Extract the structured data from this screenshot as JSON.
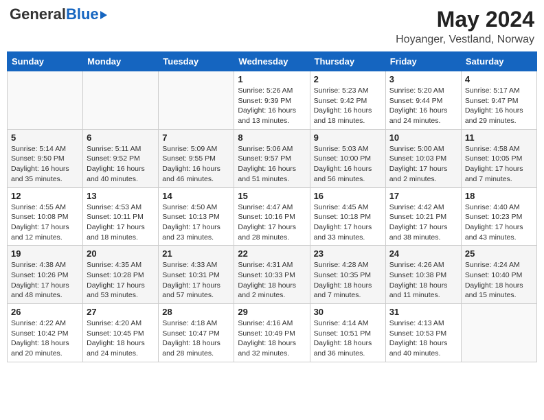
{
  "header": {
    "logo_general": "General",
    "logo_blue": "Blue",
    "main_title": "May 2024",
    "subtitle": "Hoyanger, Vestland, Norway"
  },
  "days_of_week": [
    "Sunday",
    "Monday",
    "Tuesday",
    "Wednesday",
    "Thursday",
    "Friday",
    "Saturday"
  ],
  "weeks": [
    [
      {
        "day": "",
        "info": ""
      },
      {
        "day": "",
        "info": ""
      },
      {
        "day": "",
        "info": ""
      },
      {
        "day": "1",
        "info": "Sunrise: 5:26 AM\nSunset: 9:39 PM\nDaylight: 16 hours and 13 minutes."
      },
      {
        "day": "2",
        "info": "Sunrise: 5:23 AM\nSunset: 9:42 PM\nDaylight: 16 hours and 18 minutes."
      },
      {
        "day": "3",
        "info": "Sunrise: 5:20 AM\nSunset: 9:44 PM\nDaylight: 16 hours and 24 minutes."
      },
      {
        "day": "4",
        "info": "Sunrise: 5:17 AM\nSunset: 9:47 PM\nDaylight: 16 hours and 29 minutes."
      }
    ],
    [
      {
        "day": "5",
        "info": "Sunrise: 5:14 AM\nSunset: 9:50 PM\nDaylight: 16 hours and 35 minutes."
      },
      {
        "day": "6",
        "info": "Sunrise: 5:11 AM\nSunset: 9:52 PM\nDaylight: 16 hours and 40 minutes."
      },
      {
        "day": "7",
        "info": "Sunrise: 5:09 AM\nSunset: 9:55 PM\nDaylight: 16 hours and 46 minutes."
      },
      {
        "day": "8",
        "info": "Sunrise: 5:06 AM\nSunset: 9:57 PM\nDaylight: 16 hours and 51 minutes."
      },
      {
        "day": "9",
        "info": "Sunrise: 5:03 AM\nSunset: 10:00 PM\nDaylight: 16 hours and 56 minutes."
      },
      {
        "day": "10",
        "info": "Sunrise: 5:00 AM\nSunset: 10:03 PM\nDaylight: 17 hours and 2 minutes."
      },
      {
        "day": "11",
        "info": "Sunrise: 4:58 AM\nSunset: 10:05 PM\nDaylight: 17 hours and 7 minutes."
      }
    ],
    [
      {
        "day": "12",
        "info": "Sunrise: 4:55 AM\nSunset: 10:08 PM\nDaylight: 17 hours and 12 minutes."
      },
      {
        "day": "13",
        "info": "Sunrise: 4:53 AM\nSunset: 10:11 PM\nDaylight: 17 hours and 18 minutes."
      },
      {
        "day": "14",
        "info": "Sunrise: 4:50 AM\nSunset: 10:13 PM\nDaylight: 17 hours and 23 minutes."
      },
      {
        "day": "15",
        "info": "Sunrise: 4:47 AM\nSunset: 10:16 PM\nDaylight: 17 hours and 28 minutes."
      },
      {
        "day": "16",
        "info": "Sunrise: 4:45 AM\nSunset: 10:18 PM\nDaylight: 17 hours and 33 minutes."
      },
      {
        "day": "17",
        "info": "Sunrise: 4:42 AM\nSunset: 10:21 PM\nDaylight: 17 hours and 38 minutes."
      },
      {
        "day": "18",
        "info": "Sunrise: 4:40 AM\nSunset: 10:23 PM\nDaylight: 17 hours and 43 minutes."
      }
    ],
    [
      {
        "day": "19",
        "info": "Sunrise: 4:38 AM\nSunset: 10:26 PM\nDaylight: 17 hours and 48 minutes."
      },
      {
        "day": "20",
        "info": "Sunrise: 4:35 AM\nSunset: 10:28 PM\nDaylight: 17 hours and 53 minutes."
      },
      {
        "day": "21",
        "info": "Sunrise: 4:33 AM\nSunset: 10:31 PM\nDaylight: 17 hours and 57 minutes."
      },
      {
        "day": "22",
        "info": "Sunrise: 4:31 AM\nSunset: 10:33 PM\nDaylight: 18 hours and 2 minutes."
      },
      {
        "day": "23",
        "info": "Sunrise: 4:28 AM\nSunset: 10:35 PM\nDaylight: 18 hours and 7 minutes."
      },
      {
        "day": "24",
        "info": "Sunrise: 4:26 AM\nSunset: 10:38 PM\nDaylight: 18 hours and 11 minutes."
      },
      {
        "day": "25",
        "info": "Sunrise: 4:24 AM\nSunset: 10:40 PM\nDaylight: 18 hours and 15 minutes."
      }
    ],
    [
      {
        "day": "26",
        "info": "Sunrise: 4:22 AM\nSunset: 10:42 PM\nDaylight: 18 hours and 20 minutes."
      },
      {
        "day": "27",
        "info": "Sunrise: 4:20 AM\nSunset: 10:45 PM\nDaylight: 18 hours and 24 minutes."
      },
      {
        "day": "28",
        "info": "Sunrise: 4:18 AM\nSunset: 10:47 PM\nDaylight: 18 hours and 28 minutes."
      },
      {
        "day": "29",
        "info": "Sunrise: 4:16 AM\nSunset: 10:49 PM\nDaylight: 18 hours and 32 minutes."
      },
      {
        "day": "30",
        "info": "Sunrise: 4:14 AM\nSunset: 10:51 PM\nDaylight: 18 hours and 36 minutes."
      },
      {
        "day": "31",
        "info": "Sunrise: 4:13 AM\nSunset: 10:53 PM\nDaylight: 18 hours and 40 minutes."
      },
      {
        "day": "",
        "info": ""
      }
    ]
  ]
}
